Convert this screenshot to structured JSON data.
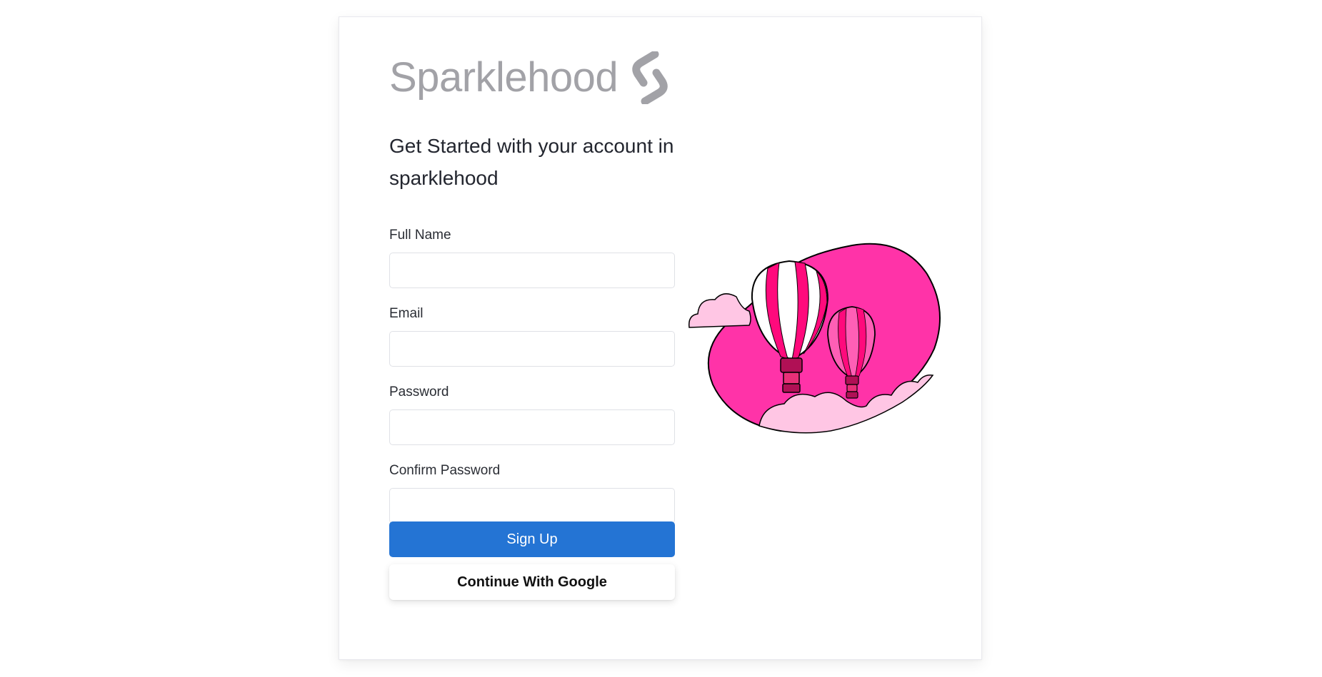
{
  "brand": {
    "name": "Sparklehood",
    "logo_icon": "sparklehood-s-logo",
    "logo_color": "#a2a2a7"
  },
  "heading": "Get Started with your account in sparklehood",
  "form": {
    "full_name_label": "Full Name",
    "full_name_value": "",
    "email_label": "Email",
    "email_value": "",
    "password_label": "Password",
    "password_value": "",
    "confirm_password_label": "Confirm Password",
    "confirm_password_value": ""
  },
  "buttons": {
    "sign_up": "Sign Up",
    "google": "Continue With Google"
  },
  "illustration": {
    "icon": "hot-air-balloons-illustration"
  },
  "colors": {
    "primary": "#2474d4",
    "blob_pink": "#ff33a8",
    "cloud_pink": "#ffc6e4",
    "balloon_magenta": "#ff0a7c"
  }
}
